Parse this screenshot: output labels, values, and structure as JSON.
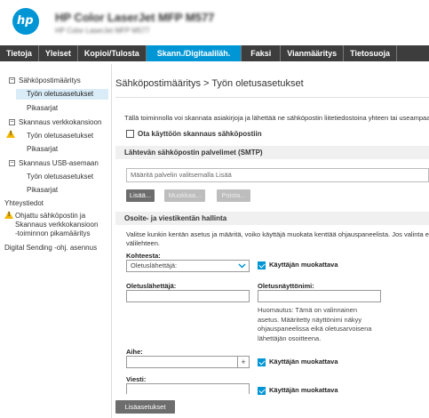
{
  "header": {
    "logo_text": "hp",
    "printer_name": "HP Color LaserJet MFP M577",
    "printer_subtitle": "HP Color LaserJet MFP M577"
  },
  "nav": {
    "tabs": [
      {
        "label": "Tietoja"
      },
      {
        "label": "Yleiset"
      },
      {
        "label": "Kopioi/Tulosta"
      },
      {
        "label": "Skann./Digitaaliläh."
      },
      {
        "label": "Faksi"
      },
      {
        "label": "Vianmääritys"
      },
      {
        "label": "Tietosuoja"
      }
    ],
    "active_index": 3
  },
  "sidebar": {
    "email_setup": "Sähköpostimääritys",
    "email_defaults": "Työn oletusasetukset",
    "email_quicksets": "Pikasarjat",
    "network_folder": "Skannaus verkkokansioon",
    "folder_defaults": "Työn oletusasetukset",
    "folder_quicksets": "Pikasarjat",
    "usb": "Skannaus USB-asemaan",
    "usb_defaults": "Työn oletusasetukset",
    "usb_quicksets": "Pikasarjat",
    "contacts": "Yhteystiedot",
    "wizard_line1": "Ohjattu sähköpostin ja",
    "wizard_line2": "Skannaus verkkokansioon",
    "wizard_line3": "-toiminnon pikamääritys",
    "digital_sending": "Digital Sending -ohj. asennus"
  },
  "main": {
    "title": "Sähköpostimääritys > Työn oletusasetukset",
    "intro": "Tällä toiminnolla voi skannata asiakirjoja ja lähettää ne sähköpostin liitetiedostoina yhteen tai useampaan s",
    "enable_label": "Ota käyttöön skannaus sähköpostiin",
    "smtp_section": "Lähtevän sähköpostin palvelimet (SMTP)",
    "smtp_placeholder": "Määritä palvelin valitsemalla Lisää",
    "add_button": "Lisää...",
    "edit_button": "Muokkaa...",
    "delete_button": "Poista...",
    "address_section": "Osoite- ja viestikentän hallinta",
    "address_desc_1": "Valitse kunkin kentän asetus ja määritä, voiko käyttäjä muokata kenttää ohjauspaneelista. Jos valinta edell",
    "address_desc_2": "välilehteen.",
    "from_label": "Kohteesta:",
    "from_value": "Oletuslähettäjä:",
    "user_editable": "Käyttäjän muokattava",
    "default_from_label": "Oletuslähettäjä:",
    "default_display_label": "Oletusnäyttönimi:",
    "note": "Huomautus: Tämä on valinnainen asetus. Määritetty näyttönimi näkyy ohjauspaneelissa eikä oletusarvoisena lähettäjän osoitteena.",
    "subject_label": "Aihe:",
    "subject_plus": "+",
    "message_label": "Viesti:",
    "advanced_button": "Lisäasetukset"
  }
}
